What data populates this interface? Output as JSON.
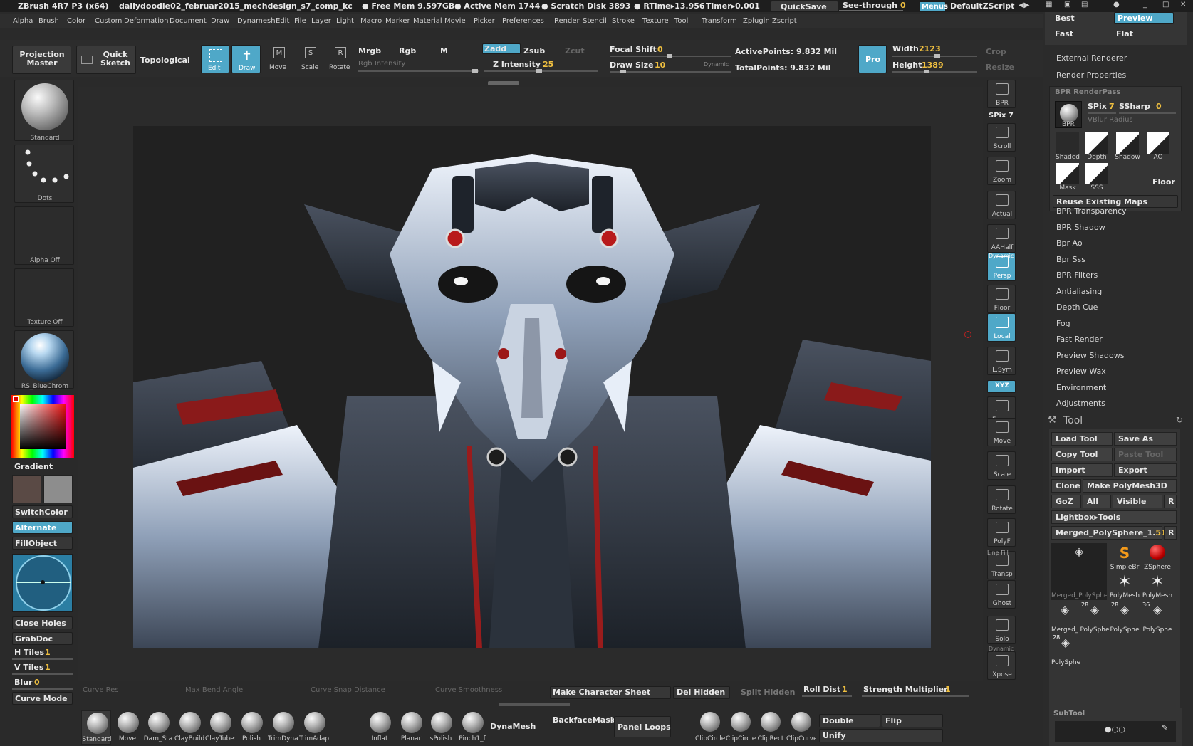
{
  "titlebar": {
    "app": "ZBrush 4R7 P3 (x64)",
    "document": "dailydoodle02_februar2015_mechdesign_s7_comp_kc",
    "free_mem": "● Free Mem 9.597GB",
    "active_mem": "● Active Mem 1744",
    "scratch": "● Scratch Disk 3893",
    "rtime": "● RTime▸13.956",
    "timer": "Timer▸0.001",
    "quicksave": "QuickSave",
    "seethrough": "See-through",
    "seethrough_val": "0",
    "menus": "Menus",
    "script": "DefaultZScript"
  },
  "menubar": [
    "Alpha",
    "Brush",
    "Color",
    "Custom",
    "Deformation",
    "Document",
    "Draw",
    "Dynamesh",
    "Edit",
    "File",
    "Layer",
    "Light",
    "Macro",
    "Marker",
    "Material",
    "Movie",
    "Picker",
    "Preferences",
    "Render",
    "Stencil",
    "Stroke",
    "Texture",
    "Tool",
    "Transform",
    "Zplugin",
    "Zscript"
  ],
  "toolbar": {
    "projection_master": "Projection Master",
    "quick_sketch": "Quick Sketch",
    "topological": "Topological",
    "edit": "Edit",
    "draw": "Draw",
    "move": "Move",
    "scale": "Scale",
    "rotate": "Rotate",
    "mrgb": "Mrgb",
    "rgb": "Rgb",
    "m": "M",
    "zadd": "Zadd",
    "zsub": "Zsub",
    "zcut": "Zcut",
    "rgb_intensity": "Rgb Intensity",
    "z_intensity": "Z Intensity",
    "z_intensity_val": "25",
    "focal_shift": "Focal Shift",
    "focal_shift_val": "0",
    "draw_size": "Draw Size",
    "draw_size_val": "10",
    "dynamic": "Dynamic",
    "active_points": "ActivePoints: 9.832 Mil",
    "total_points": "TotalPoints: 9.832 Mil",
    "pro": "Pro",
    "width_label": "Width",
    "width_val": "2123",
    "height_label": "Height",
    "height_val": "1389",
    "crop": "Crop",
    "resize": "Resize"
  },
  "left_shelf": {
    "brush": "Standard",
    "stroke": "Dots",
    "alpha": "Alpha Off",
    "texture": "Texture Off",
    "material": "RS_BlueChrom",
    "gradient": "Gradient",
    "switch_color": "SwitchColor",
    "alternate": "Alternate",
    "fill_object": "FillObject",
    "close_holes": "Close Holes",
    "grab_doc": "GrabDoc",
    "h_tiles": "H Tiles",
    "h_tiles_val": "1",
    "v_tiles": "V Tiles",
    "v_tiles_val": "1",
    "blur": "Blur",
    "blur_val": "0",
    "curve_mode": "Curve Mode"
  },
  "right_shelf": [
    {
      "icon": "bpr-icon",
      "label": "BPR"
    },
    {
      "icon": "spix-icon",
      "label": "SPix 7"
    },
    {
      "icon": "scroll-icon",
      "label": "Scroll"
    },
    {
      "icon": "zoom-icon",
      "label": "Zoom"
    },
    {
      "icon": "actual-icon",
      "label": "Actual"
    },
    {
      "icon": "aahalf-icon",
      "label": "AAHalf"
    },
    {
      "icon": "persp-icon",
      "label": "Persp"
    },
    {
      "icon": "floor-icon",
      "label": "Floor"
    },
    {
      "icon": "local-icon",
      "label": "Local"
    },
    {
      "icon": "lsym-icon",
      "label": "L.Sym"
    },
    {
      "icon": "xyz-icon",
      "label": "XYZ"
    },
    {
      "icon": "frame-icon",
      "label": "Frame"
    },
    {
      "icon": "move-icon",
      "label": "Move"
    },
    {
      "icon": "scale-icon",
      "label": "Scale"
    },
    {
      "icon": "rotate-icon",
      "label": "Rotate"
    },
    {
      "icon": "polyf-icon",
      "label": "PolyF"
    },
    {
      "icon": "transp-icon",
      "label": "Transp"
    },
    {
      "icon": "ghost-icon",
      "label": "Ghost"
    },
    {
      "icon": "solo-icon",
      "label": "Solo"
    },
    {
      "icon": "xpose-icon",
      "label": "Xpose"
    }
  ],
  "right_shelf_extra": {
    "line_fill": "Line Fill",
    "dynamic_persp": "Dynamic",
    "dynamic_solo": "Dynamic"
  },
  "render_panel": {
    "best": "Best",
    "preview": "Preview",
    "fast": "Fast",
    "flat": "Flat",
    "external_renderer": "External Renderer",
    "render_properties": "Render Properties",
    "bpr_renderpass": "BPR  RenderPass",
    "spix": "SPix",
    "spix_val": "7",
    "ssharp": "SSharp",
    "ssharp_val": "0",
    "vblur": "VBlur Radius",
    "bpr": "BPR",
    "passes": [
      "Shaded",
      "Depth",
      "Shadow",
      "AO",
      "Mask",
      "SSS"
    ],
    "floor": "Floor",
    "reuse": "Reuse Existing Maps",
    "sections": [
      "BPR Transparency",
      "BPR Shadow",
      "Bpr Ao",
      "Bpr Sss",
      "BPR Filters",
      "Antialiasing",
      "Depth Cue",
      "Fog",
      "Fast Render",
      "Preview Shadows",
      "Preview Wax",
      "Environment",
      "Adjustments"
    ]
  },
  "tool_panel": {
    "title": "Tool",
    "load": "Load Tool",
    "save_as": "Save As",
    "copy": "Copy Tool",
    "paste": "Paste Tool",
    "import": "Import",
    "export": "Export",
    "clone": "Clone",
    "make_polymesh": "Make PolyMesh3D",
    "goz": "GoZ",
    "all": "All",
    "visible": "Visible",
    "r": "R",
    "lightbox": "Lightbox▸Tools",
    "current_tool": "Merged_PolySphere_1.",
    "current_tool_num": "51",
    "thumbs": [
      {
        "label": "Merged_PolySpher"
      },
      {
        "label": "SimpleBr"
      },
      {
        "label": "ZSphere"
      },
      {
        "label": "PolyMesh"
      },
      {
        "label": "PolyMesh"
      },
      {
        "label": "Merged_"
      },
      {
        "label": "PolySphe",
        "count": "28"
      },
      {
        "label": "PolySphe",
        "count": "28"
      },
      {
        "label": "PolySphe",
        "count": "36"
      },
      {
        "label": "PolySphe",
        "count": "28"
      }
    ],
    "subtool": "SubTool"
  },
  "bottom_bar": {
    "curve_res": "Curve Res",
    "max_bend": "Max Bend Angle",
    "curve_snap": "Curve Snap Distance",
    "curve_smooth": "Curve Smoothness",
    "make_char": "Make Character Sheet",
    "del_hidden": "Del Hidden",
    "split_hidden": "Split Hidden",
    "roll_dist": "Roll Dist",
    "roll_dist_val": "1",
    "strength_mult": "Strength Multiplier",
    "strength_mult_val": "1"
  },
  "bottom_shelf": {
    "brushes": [
      "Standard",
      "Move",
      "Dam_Sta",
      "ClayBuild",
      "ClayTube:",
      "Polish",
      "TrimDyna",
      "TrimAdap",
      "Inflat",
      "Planar",
      "sPolish",
      "Pinch1_f"
    ],
    "dynamesh": "DynaMesh",
    "backface": "BackfaceMask",
    "panel_loops": "Panel Loops",
    "clips": [
      "ClipCircle",
      "ClipCircle",
      "ClipRect",
      "ClipCurve"
    ],
    "double": "Double",
    "flip": "Flip",
    "unify": "Unify"
  },
  "colors": {
    "accent": "#4fa8c8",
    "highlight_value": "#f0c040",
    "bg": "#2a2a2a",
    "panel": "#373737"
  }
}
